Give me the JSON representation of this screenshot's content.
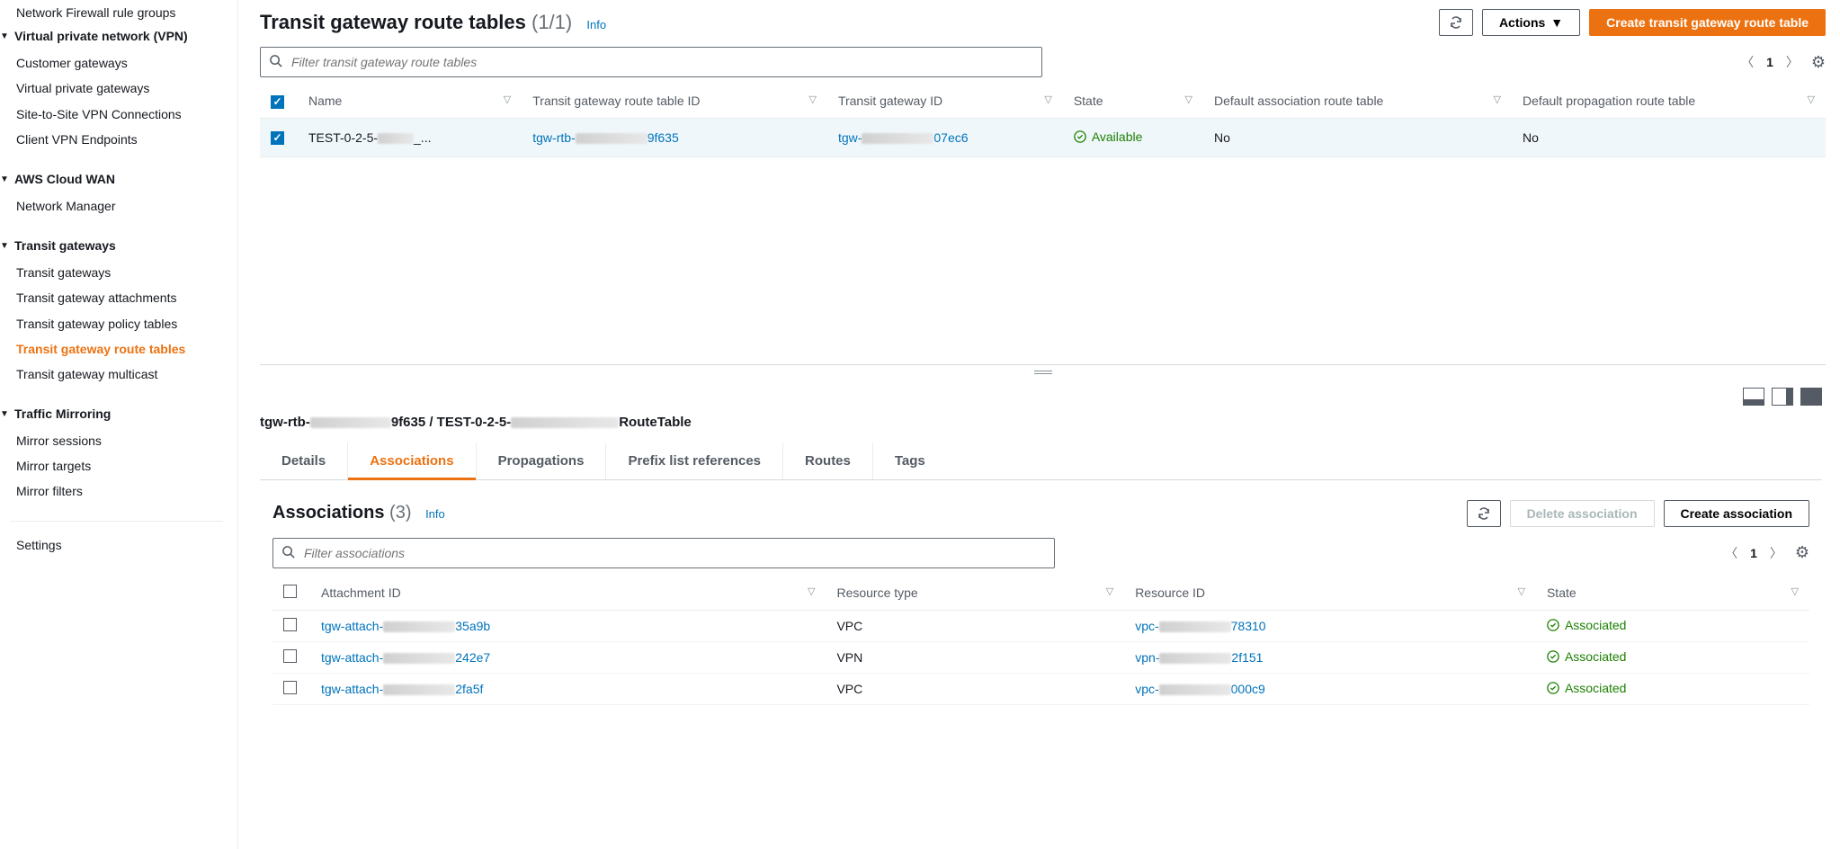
{
  "sidebar": {
    "items": [
      {
        "label": "Network Firewall rule groups",
        "type": "item"
      },
      {
        "label": "Virtual private network (VPN)",
        "type": "header"
      },
      {
        "label": "Customer gateways",
        "type": "item"
      },
      {
        "label": "Virtual private gateways",
        "type": "item"
      },
      {
        "label": "Site-to-Site VPN Connections",
        "type": "item"
      },
      {
        "label": "Client VPN Endpoints",
        "type": "item"
      },
      {
        "label": "AWS Cloud WAN",
        "type": "header"
      },
      {
        "label": "Network Manager",
        "type": "item"
      },
      {
        "label": "Transit gateways",
        "type": "header"
      },
      {
        "label": "Transit gateways",
        "type": "item"
      },
      {
        "label": "Transit gateway attachments",
        "type": "item"
      },
      {
        "label": "Transit gateway policy tables",
        "type": "item"
      },
      {
        "label": "Transit gateway route tables",
        "type": "item",
        "active": true
      },
      {
        "label": "Transit gateway multicast",
        "type": "item"
      },
      {
        "label": "Traffic Mirroring",
        "type": "header"
      },
      {
        "label": "Mirror sessions",
        "type": "item"
      },
      {
        "label": "Mirror targets",
        "type": "item"
      },
      {
        "label": "Mirror filters",
        "type": "item"
      }
    ],
    "settings": "Settings"
  },
  "header": {
    "title": "Transit gateway route tables",
    "count": "(1/1)",
    "info": "Info",
    "actions": "Actions",
    "create": "Create transit gateway route table"
  },
  "filter": {
    "placeholder": "Filter transit gateway route tables",
    "page": "1"
  },
  "table": {
    "columns": [
      "Name",
      "Transit gateway route table ID",
      "Transit gateway ID",
      "State",
      "Default association route table",
      "Default propagation route table"
    ],
    "row": {
      "name_prefix": "TEST-0-2-5-",
      "name_suffix": "_...",
      "rtb_prefix": "tgw-rtb-",
      "rtb_suffix": "9f635",
      "tgw_prefix": "tgw-",
      "tgw_suffix": "07ec6",
      "state": "Available",
      "assoc": "No",
      "prop": "No"
    }
  },
  "detail": {
    "title_prefix": "tgw-rtb-",
    "title_mid": "9f635 / TEST-0-2-5-",
    "title_suffix": "RouteTable",
    "tabs": [
      "Details",
      "Associations",
      "Propagations",
      "Prefix list references",
      "Routes",
      "Tags"
    ],
    "active_tab": 1
  },
  "assoc": {
    "title": "Associations",
    "count": "(3)",
    "info": "Info",
    "delete": "Delete association",
    "create": "Create association",
    "filter_placeholder": "Filter associations",
    "page": "1",
    "columns": [
      "Attachment ID",
      "Resource type",
      "Resource ID",
      "State"
    ],
    "rows": [
      {
        "attach_prefix": "tgw-attach-",
        "attach_suffix": "35a9b",
        "rtype": "VPC",
        "rid_prefix": "vpc-",
        "rid_suffix": "78310",
        "state": "Associated"
      },
      {
        "attach_prefix": "tgw-attach-",
        "attach_suffix": "242e7",
        "rtype": "VPN",
        "rid_prefix": "vpn-",
        "rid_suffix": "2f151",
        "state": "Associated"
      },
      {
        "attach_prefix": "tgw-attach-",
        "attach_suffix": "2fa5f",
        "rtype": "VPC",
        "rid_prefix": "vpc-",
        "rid_suffix": "000c9",
        "state": "Associated"
      }
    ]
  }
}
